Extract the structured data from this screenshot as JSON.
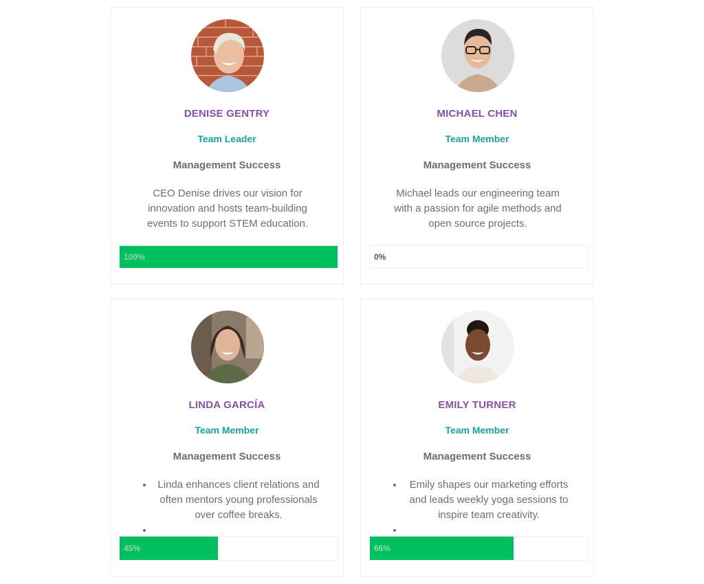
{
  "team": [
    {
      "name": "DENISE GENTRY",
      "role": "Team Leader",
      "skill": "Management Success",
      "description": "CEO Denise drives our vision for innovation and hosts team-building events to support STEM education.",
      "progress": 100,
      "progress_label": "100%"
    },
    {
      "name": "MICHAEL CHEN",
      "role": "Team Member",
      "skill": "Management Success",
      "description": "Michael leads our engineering team with a passion for agile methods and open source projects.",
      "progress": 0,
      "progress_label": "0%"
    },
    {
      "name": "LINDA GARCÍA",
      "role": "Team Member",
      "skill": "Management Success",
      "description": "Linda enhances client relations and often mentors young professionals over coffee breaks.",
      "progress": 45,
      "progress_label": "45%"
    },
    {
      "name": "EMILY TURNER",
      "role": "Team Member",
      "skill": "Management Success",
      "description": "Emily shapes our marketing efforts and leads weekly yoga sessions to inspire team creativity.",
      "progress": 66,
      "progress_label": "66%"
    }
  ],
  "colors": {
    "name": "#8a4fa6",
    "role": "#1a9ea6",
    "bar_fill": "#00bf5f"
  }
}
